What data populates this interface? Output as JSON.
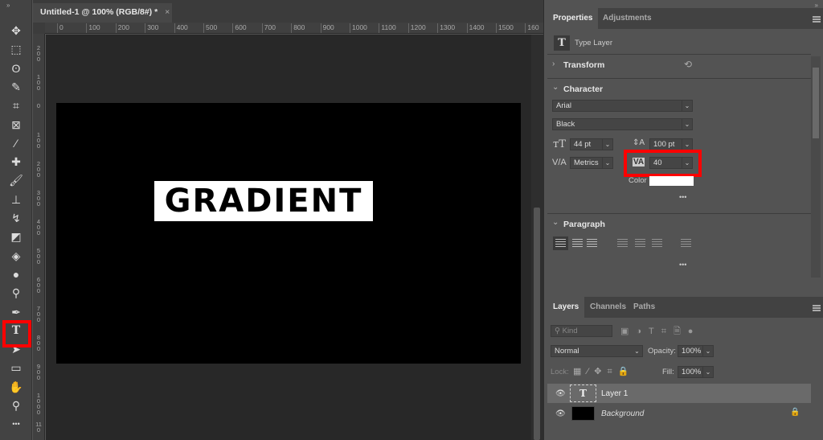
{
  "document": {
    "tab_title": "Untitled-1 @ 100% (RGB/8#) *",
    "close": "×",
    "canvas_text": "GRADIENT"
  },
  "rulers": {
    "horizontal": [
      "0",
      "100",
      "200",
      "300",
      "400",
      "500",
      "600",
      "700",
      "800",
      "900",
      "1000",
      "1100",
      "1200",
      "1300",
      "1400",
      "1500",
      "160"
    ],
    "vertical": [
      "200",
      "100",
      "0",
      "100",
      "200",
      "300",
      "400",
      "500",
      "600",
      "700",
      "800",
      "900",
      "1000",
      "110"
    ]
  },
  "toolbar": {
    "collapse": "»",
    "tools": [
      {
        "name": "move-tool",
        "glyph": "✥"
      },
      {
        "name": "marquee-tool",
        "glyph": "⬚"
      },
      {
        "name": "lasso-tool",
        "glyph": "ʘ"
      },
      {
        "name": "quick-select-tool",
        "glyph": "✎"
      },
      {
        "name": "crop-tool",
        "glyph": "⌗"
      },
      {
        "name": "frame-tool",
        "glyph": "⊠"
      },
      {
        "name": "eyedropper-tool",
        "glyph": "⁄"
      },
      {
        "name": "healing-tool",
        "glyph": "✚"
      },
      {
        "name": "brush-tool",
        "glyph": "🖌"
      },
      {
        "name": "stamp-tool",
        "glyph": "⊥"
      },
      {
        "name": "history-brush-tool",
        "glyph": "↯"
      },
      {
        "name": "eraser-tool",
        "glyph": "◩"
      },
      {
        "name": "paint-bucket-tool",
        "glyph": "◈"
      },
      {
        "name": "blur-tool",
        "glyph": "●"
      },
      {
        "name": "dodge-tool",
        "glyph": "⚲"
      },
      {
        "name": "pen-tool",
        "glyph": "✒"
      },
      {
        "name": "type-tool",
        "glyph": "T",
        "active": true
      },
      {
        "name": "path-select-tool",
        "glyph": "➤"
      },
      {
        "name": "rectangle-tool",
        "glyph": "▭"
      },
      {
        "name": "hand-tool",
        "glyph": "✋"
      },
      {
        "name": "zoom-tool",
        "glyph": "⚲"
      },
      {
        "name": "more-tools",
        "glyph": "•••"
      }
    ]
  },
  "properties": {
    "tabs": [
      "Properties",
      "Adjustments"
    ],
    "collapse": "»",
    "layer_type": "Type Layer",
    "transform": "Transform",
    "character": "Character",
    "font_family": "Arial",
    "font_style": "Black",
    "font_size": "44 pt",
    "leading": "100 pt",
    "kerning": "Metrics",
    "tracking": "40",
    "color_label": "Color",
    "text_color": "#ffffff",
    "more": "•••",
    "paragraph": "Paragraph",
    "paragraph_more": "•••"
  },
  "layers": {
    "tabs": [
      "Layers",
      "Channels",
      "Paths"
    ],
    "filter_placeholder": "Kind",
    "blend_mode": "Normal",
    "opacity_label": "Opacity:",
    "opacity": "100%",
    "lock_label": "Lock:",
    "fill_label": "Fill:",
    "fill": "100%",
    "items": [
      {
        "name": "Layer 1",
        "type": "text",
        "visible": true,
        "selected": true
      },
      {
        "name": "Background",
        "type": "fill",
        "visible": true,
        "locked": true
      }
    ]
  },
  "colors": {
    "highlight": "#ff0000",
    "panel_bg": "#535353",
    "canvas_bg": "#282828"
  }
}
